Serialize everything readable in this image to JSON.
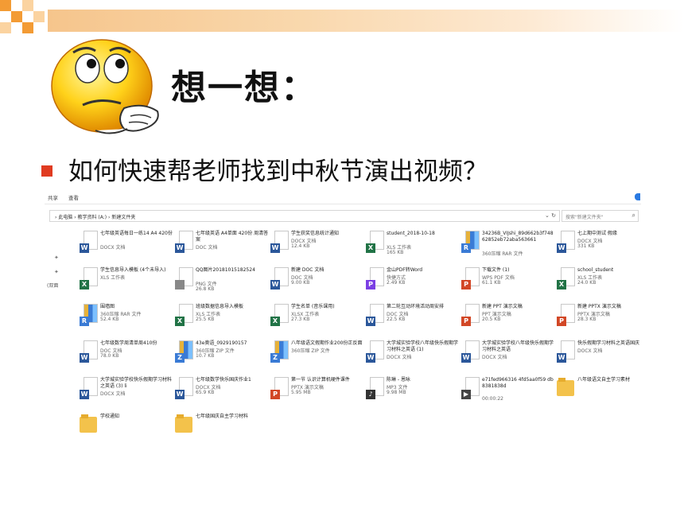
{
  "title": "想一想：",
  "question": "如何快速帮老师找到中秋节演出视频？",
  "colors": {
    "bullet": "#e03b20",
    "accent_orange": "#f39b34"
  },
  "explorer": {
    "ribbon": [
      "共享",
      "查看"
    ],
    "address": "› 此电脑 › 教学资料 (A:) › 新建文件夹",
    "search_placeholder": "搜索\"新建文件夹\"",
    "nav_label": "(双面",
    "files": [
      {
        "name": "七年级英语每日一练14 A4 420份",
        "type": "DOCX 文档",
        "size": "",
        "icon": "word"
      },
      {
        "name": "七年级英语 A4单面 420份 周清答案",
        "type": "DOC 文档",
        "size": "",
        "icon": "word"
      },
      {
        "name": "学生获奖信息统计通知",
        "type": "DOCX 文档",
        "size": "12.4 KB",
        "icon": "word"
      },
      {
        "name": "student_2018-10-18",
        "type": "XLS 工作表",
        "size": "165 KB",
        "icon": "excel"
      },
      {
        "name": "34236B_VIJshi_89d662b3f74862852eb72aba563661",
        "type": "360压缩 RAR 文件",
        "size": "",
        "icon": "rar"
      },
      {
        "name": "七上期中测试 假缘",
        "type": "DOCX 文档",
        "size": "331 KB",
        "icon": "word"
      },
      {
        "name": "学生信息导入模板 (4个未导入)",
        "type": "XLS 工作表",
        "size": "",
        "icon": "excel"
      },
      {
        "name": "QQ图片20181015182524",
        "type": "PNG 文件",
        "size": "26.8 KB",
        "icon": "png"
      },
      {
        "name": "新建 DOC 文档",
        "type": "DOC 文档",
        "size": "9.00 KB",
        "icon": "word"
      },
      {
        "name": "金山PDF转Word",
        "type": "快捷方式",
        "size": "2.49 KB",
        "icon": "pdfw"
      },
      {
        "name": "下载文件 (1)",
        "type": "WPS PDF 文档",
        "size": "61.1 KB",
        "icon": "pdf"
      },
      {
        "name": "school_student",
        "type": "XLS 工作表",
        "size": "24.0 KB",
        "icon": "excel"
      },
      {
        "name": "围墙图",
        "type": "360压缩 RAR 文件",
        "size": "52.4 KB",
        "icon": "rar"
      },
      {
        "name": "班级数据信息导入模板",
        "type": "XLS 工作表",
        "size": "25.5 KB",
        "icon": "excel"
      },
      {
        "name": "学生名单 (音乐课用)",
        "type": "XLSX 工作表",
        "size": "27.3 KB",
        "icon": "excel"
      },
      {
        "name": "第二轮互动环境活动周安排",
        "type": "DOC 文档",
        "size": "22.5 KB",
        "icon": "word"
      },
      {
        "name": "新建 PPT 演示文稿",
        "type": "PPT 演示文稿",
        "size": "20.5 KB",
        "icon": "ppt"
      },
      {
        "name": "新建 PPTX 演示文稿",
        "type": "PPTX 演示文稿",
        "size": "28.3 KB",
        "icon": "ppt"
      },
      {
        "name": "七年级数学周清单周410份",
        "type": "DOC 文档",
        "size": "78.0 KB",
        "icon": "word"
      },
      {
        "name": "43e奥语_0929190157",
        "type": "360压缩 ZIP 文件",
        "size": "10.7 KB",
        "icon": "zip"
      },
      {
        "name": "八年级语文假期作业200份正反面",
        "type": "360压缩 ZIP 文件",
        "size": "",
        "icon": "zip"
      },
      {
        "name": "大学城实验学校八年级快乐假期学习材料之英语 (1)",
        "type": "DOCX 文档",
        "size": "",
        "icon": "word"
      },
      {
        "name": "大学城实验学校八年级快乐假期学习材料之英语",
        "type": "DOCX 文档",
        "size": "",
        "icon": "word"
      },
      {
        "name": "快乐假期学习材料之英语国庆",
        "type": "DOCX 文档",
        "size": "",
        "icon": "word"
      },
      {
        "name": "大学城实验学校快乐假期学习材料之英语 (3) li",
        "type": "DOCX 文档",
        "size": "",
        "icon": "word"
      },
      {
        "name": "七年级数学快乐国庆作业1",
        "type": "DOCX 文档",
        "size": "65.9 KB",
        "icon": "word"
      },
      {
        "name": "第一节 认识计算机硬件课件",
        "type": "PPTX 演示文稿",
        "size": "5.95 MB",
        "icon": "ppt"
      },
      {
        "name": "陈琳 - 恩咏",
        "type": "MP3 文件",
        "size": "9.98 MB",
        "icon": "mp3"
      },
      {
        "name": "e71fed966316 4fd5aa0f59 db8381838d",
        "type": "",
        "size": "00:00:22",
        "icon": "video"
      },
      {
        "name": "八年级语文自主学习素材",
        "type": "",
        "size": "",
        "icon": "folder"
      },
      {
        "name": "学校通知",
        "type": "",
        "size": "",
        "icon": "folder"
      },
      {
        "name": "七年级国庆自主学习材料",
        "type": "",
        "size": "",
        "icon": "folder"
      }
    ]
  }
}
